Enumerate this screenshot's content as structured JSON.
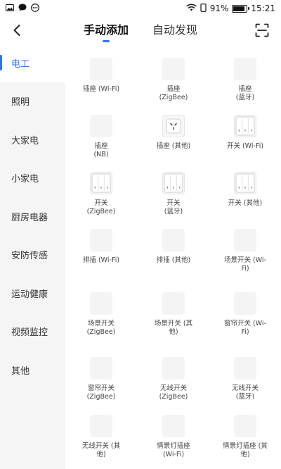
{
  "status_bar": {
    "battery_percent": "91%",
    "time": "15:21",
    "battery_level": 0.91,
    "left_icons": [
      "image-icon",
      "message-icon",
      "more-circle-icon"
    ],
    "right_icons": [
      "wifi-icon",
      "vibrate-icon",
      "battery-icon"
    ]
  },
  "header": {
    "back_icon": "chevron-left-icon",
    "scan_icon": "scan-icon",
    "tabs": [
      {
        "label": "手动添加",
        "active": true
      },
      {
        "label": "自动发现",
        "active": false
      }
    ]
  },
  "colors": {
    "accent": "#2b77f0",
    "sidebar_bg": "#f5f5f5",
    "placeholder": "#f4f4f4"
  },
  "sidebar": {
    "items": [
      {
        "label": "电工",
        "active": true
      },
      {
        "label": "照明"
      },
      {
        "label": "大家电"
      },
      {
        "label": "小家电"
      },
      {
        "label": "厨房电器"
      },
      {
        "label": "安防传感"
      },
      {
        "label": "运动健康"
      },
      {
        "label": "视频监控"
      },
      {
        "label": "其他"
      }
    ]
  },
  "devices": [
    {
      "label": "插座 (Wi-Fi)",
      "icon": "placeholder"
    },
    {
      "label": "插座\n(ZigBee)",
      "icon": "placeholder"
    },
    {
      "label": "插座\n(蓝牙)",
      "icon": "placeholder"
    },
    {
      "label": "插座\n(NB)",
      "icon": "placeholder"
    },
    {
      "label": "插座 (其他)",
      "icon": "socket-icon"
    },
    {
      "label": "开关 (Wi-Fi)",
      "icon": "switch-3gang-icon"
    },
    {
      "label": "开关\n(ZigBee)",
      "icon": "switch-3gang-icon"
    },
    {
      "label": "开关\n(蓝牙)",
      "icon": "switch-3gang-icon"
    },
    {
      "label": "开关 (其他)",
      "icon": "switch-3gang-icon"
    },
    {
      "label": "排插 (Wi-Fi)",
      "icon": "placeholder"
    },
    {
      "label": "排插 (其他)",
      "icon": "placeholder"
    },
    {
      "label": "场景开关 (Wi-\nFi)",
      "icon": "placeholder"
    },
    {
      "label": "场景开关\n(ZigBee)",
      "icon": "placeholder"
    },
    {
      "label": "场景开关 (其\n他)",
      "icon": "placeholder"
    },
    {
      "label": "窗帘开关 (Wi-\nFi)",
      "icon": "placeholder"
    },
    {
      "label": "窗帘开关\n(ZigBee)",
      "icon": "placeholder"
    },
    {
      "label": "无线开关\n(ZigBee)",
      "icon": "placeholder"
    },
    {
      "label": "无线开关\n(蓝牙)",
      "icon": "placeholder"
    },
    {
      "label": "无线开关 (其\n他)",
      "icon": "placeholder"
    },
    {
      "label": "情景灯插座\n(Wi-Fi)",
      "icon": "placeholder"
    },
    {
      "label": "情景灯插座 (其\n他)",
      "icon": "placeholder"
    }
  ]
}
